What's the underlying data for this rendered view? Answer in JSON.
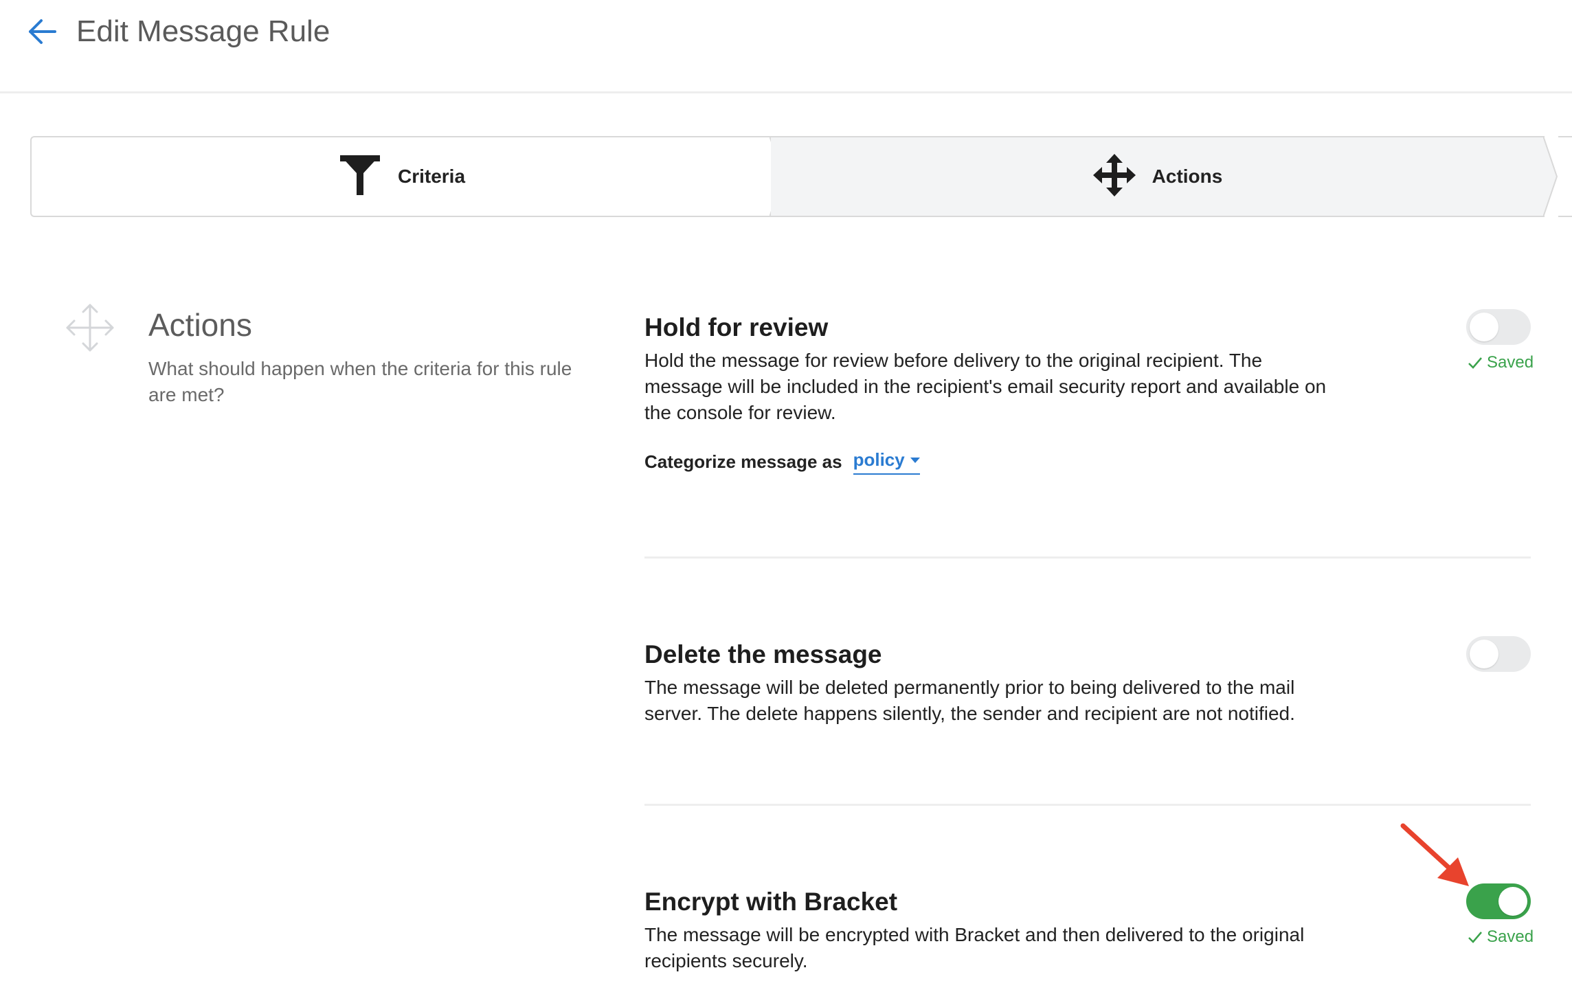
{
  "header": {
    "back_icon": "arrow-left-icon",
    "title": "Edit Message Rule"
  },
  "stepper": {
    "steps": [
      {
        "label": "Criteria",
        "icon": "funnel-icon",
        "active": false
      },
      {
        "label": "Actions",
        "icon": "move-arrows-icon",
        "active": true
      }
    ]
  },
  "section": {
    "icon": "move-arrows-icon",
    "title": "Actions",
    "description": "What should happen when the criteria for this rule are met?"
  },
  "actions": [
    {
      "title": "Hold for review",
      "description": "Hold the message for review before delivery to the original recipient. The message will be included in the recipient's email security report and available on the console for review.",
      "enabled": false,
      "status": "Saved",
      "categorize_label": "Categorize message as",
      "categorize_value": "policy"
    },
    {
      "title": "Delete the message",
      "description": "The message will be deleted permanently prior to being delivered to the mail server. The delete happens silently, the sender and recipient are not notified.",
      "enabled": false
    },
    {
      "title": "Encrypt with Bracket",
      "description": "The message will be encrypted with Bracket and then delivered to the original recipients securely.",
      "enabled": true,
      "status": "Saved"
    }
  ],
  "colors": {
    "accent_blue": "#2a7bd1",
    "toggle_on": "#3aa24b",
    "toggle_off": "#e9eaeb",
    "saved_green": "#3aa24b",
    "annotation_red": "#e8432d"
  }
}
